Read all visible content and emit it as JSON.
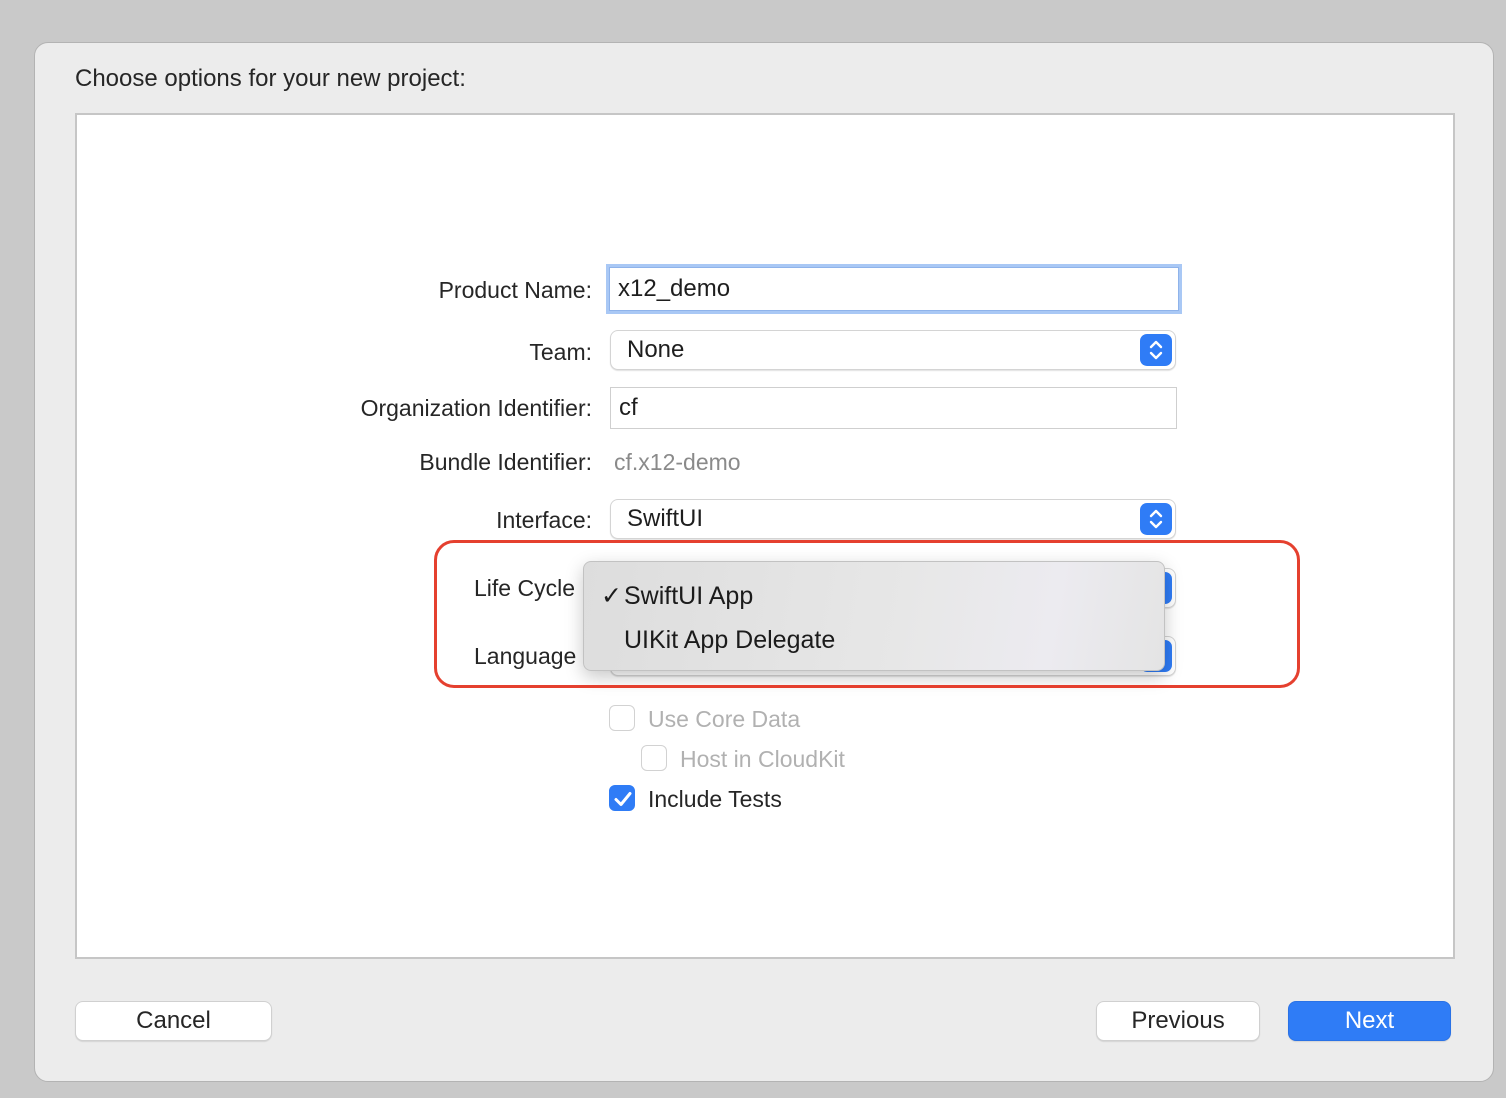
{
  "sheet": {
    "title": "Choose options for your new project:"
  },
  "form": {
    "product_name": {
      "label": "Product Name:",
      "value": "x12_demo"
    },
    "team": {
      "label": "Team:",
      "value": "None"
    },
    "organization_identifier": {
      "label": "Organization Identifier:",
      "value": "cf"
    },
    "bundle_identifier": {
      "label": "Bundle Identifier:",
      "value": "cf.x12-demo"
    },
    "interface": {
      "label": "Interface:",
      "value": "SwiftUI"
    },
    "life_cycle": {
      "label": "Life Cycle"
    },
    "language": {
      "label": "Language"
    }
  },
  "life_cycle_menu": {
    "items": [
      {
        "label": "SwiftUI App",
        "checked": true,
        "check_glyph": "✓"
      },
      {
        "label": "UIKit App Delegate",
        "checked": false,
        "check_glyph": ""
      }
    ]
  },
  "options": {
    "use_core_data": {
      "label": "Use Core Data",
      "checked": false,
      "enabled": false
    },
    "host_in_cloudkit": {
      "label": "Host in CloudKit",
      "checked": false,
      "enabled": false
    },
    "include_tests": {
      "label": "Include Tests",
      "checked": true,
      "enabled": true
    }
  },
  "buttons": {
    "cancel": "Cancel",
    "previous": "Previous",
    "next": "Next"
  },
  "colors": {
    "accent": "#2f7cf6",
    "highlight_border": "#e5402f",
    "sheet_background": "#ececec",
    "panel_background": "#ffffff"
  },
  "icons": {
    "popup_stepper": "chevron-up-down-icon",
    "checkmark": "checkmark-icon"
  }
}
